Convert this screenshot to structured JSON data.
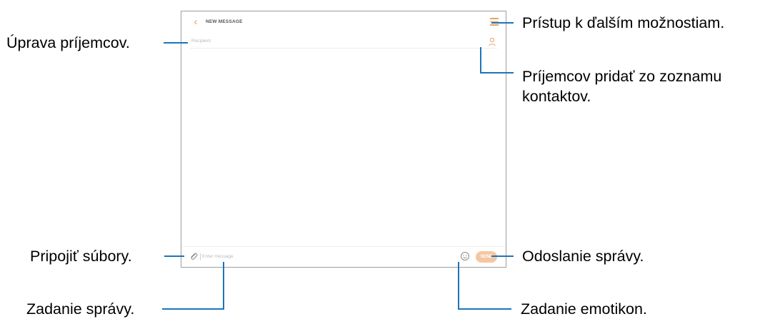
{
  "screen": {
    "title": "NEW MESSAGE",
    "recipient_placeholder": "Recipient",
    "message_placeholder": "Enter message",
    "send_label": "SEND"
  },
  "callouts": {
    "edit_recipients": "Úprava príjemcov.",
    "more_options": "Prístup k ďalším možnostiam.",
    "add_from_contacts": "Príjemcov pridať zo zoznamu kontaktov.",
    "attach_files": "Pripojiť súbory.",
    "send_message": "Odoslanie správy.",
    "enter_message": "Zadanie správy.",
    "enter_emoticons": "Zadanie emotikon."
  },
  "colors": {
    "accent": "#e8a265",
    "send_button": "#f4c7a2",
    "callout_line": "#1b75bb",
    "frame": "#9e9e9e"
  },
  "icons": {
    "back": "chevron-left-icon",
    "menu": "menu-icon",
    "contact": "contact-icon",
    "attach": "paperclip-icon",
    "emoji": "emoji-icon"
  }
}
